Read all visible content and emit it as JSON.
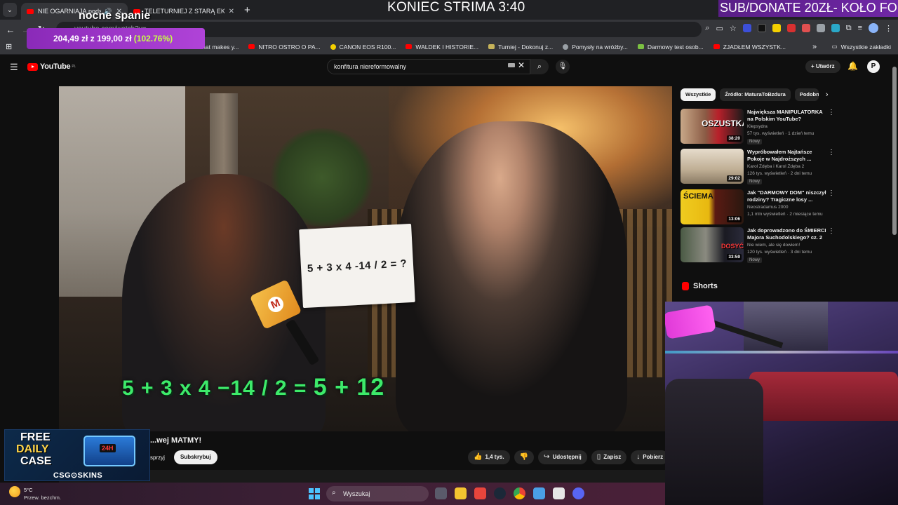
{
  "browser": {
    "tabs": [
      {
        "title": "NIE OGARNIAJĄ podstawo",
        "active": true
      },
      {
        "title": "TELETURNIEJ Z STARĄ EKIPĄ FR",
        "active": false
      }
    ],
    "new_tab": "+",
    "address": "youtube.com/watch?v=...",
    "bookmarks": [
      {
        "label": "Music that makes y...",
        "color": "#ff0000"
      },
      {
        "label": "NITRO OSTRO O PA...",
        "color": "#ff0000"
      },
      {
        "label": "CANON EOS R100...",
        "color": "#f4d000"
      },
      {
        "label": "WALDEK I HISTORIE...",
        "color": "#ff0000"
      },
      {
        "label": "Turniej - Dokonuj z...",
        "color": "#c6b35a"
      },
      {
        "label": "Pomysły na wróżby...",
        "color": "#9aa0a6"
      },
      {
        "label": "Darmowy test osob...",
        "color": "#7cc142"
      },
      {
        "label": "ZJADŁEM WSZYSTK...",
        "color": "#ff0000"
      }
    ],
    "bookmarks_all": "Wszystkie zakładki",
    "more_bookmarks": "»"
  },
  "youtube": {
    "logo_text": "YouTube",
    "logo_region": "PL",
    "search_value": "konfitura niereformowalny",
    "create_label": "Utwórz",
    "avatar_letter": "P",
    "video": {
      "card_text": "5 + 3 x 4 -14 / 2 = ?",
      "mic_letter": "M",
      "equation": "5 + 3 x 4 −14 / 2 =",
      "equation_result": "5 + 12",
      "title": "...wej MATMY!",
      "channel_partial": "sprzyj",
      "subscribe_label": "Subskrybuj",
      "likes": "1,4 tys.",
      "share_label": "Udostępnij",
      "save_label": "Zapisz",
      "download_label": "Pobierz",
      "more_label": "…"
    },
    "chips": [
      {
        "label": "Wszystkie",
        "active": true
      },
      {
        "label": "Źródło: MaturaToBzdura",
        "active": false
      },
      {
        "label": "Podobne",
        "active": false
      }
    ],
    "recommendations": [
      {
        "title": "Największa MANIPULATORKA na Polskim YouTube?",
        "channel": "Klepsydra",
        "meta": "57 tys. wyświetleń · 1 dzień temu",
        "badge": "Nowy",
        "duration": "38:20",
        "thumb_label": "OSZUSTKA?",
        "thumb_color": "#b8202a"
      },
      {
        "title": "Wypróbowałem Najtańsze Pokoje w Najdroższych ...",
        "channel": "Karol Zdęba i Karol Zdęba 2",
        "meta": "126 tys. wyświetleń · 2 dni temu",
        "badge": "Nowy",
        "duration": "29:02",
        "thumb_label": "",
        "thumb_color": "#c8b8a0"
      },
      {
        "title": "Jak \"DARMOWY DOM\" niszczył rodziny? Tragiczne losy ...",
        "channel": "Neostradamus 2000",
        "meta": "1,1 mln wyświetleń · 2 miesiące temu",
        "badge": "",
        "duration": "13:06",
        "thumb_label": "ŚCIEMA",
        "thumb_color": "#e8c020"
      },
      {
        "title": "Jak doprowadzono do ŚMIERCI Majora Suchodolskiego? cz. 2",
        "channel": "Nie wiem, ale się dowiem!",
        "meta": "120 tys. wyświetleń · 3 dni temu",
        "badge": "Nowy",
        "duration": "33:59",
        "thumb_label": "DOSYĆ",
        "thumb_color": "#5a6a7a"
      }
    ],
    "shorts_label": "Shorts"
  },
  "overlay": {
    "stream_title": "KONIEC STRIMA 3:40",
    "donate": "SUB/DONATE 20ZŁ- KOŁO FO",
    "sleep_label": "nocne spanie",
    "goal_current": "204,49 zł",
    "goal_sep": "z",
    "goal_target": "199,00 zł",
    "goal_pct": "(102.76%)",
    "ad_line1": "FREE",
    "ad_line2": "DAILY",
    "ad_line3": "CASE",
    "ad_badge": "24H",
    "ad_brand": "CSG⊙SKINS"
  },
  "taskbar": {
    "temp": "5°C",
    "weather": "Przew. bezchm.",
    "search_placeholder": "Wyszukaj",
    "apps": [
      "task-view",
      "file-explorer",
      "store",
      "steam",
      "chrome",
      "photos",
      "notepad",
      "discord"
    ]
  }
}
